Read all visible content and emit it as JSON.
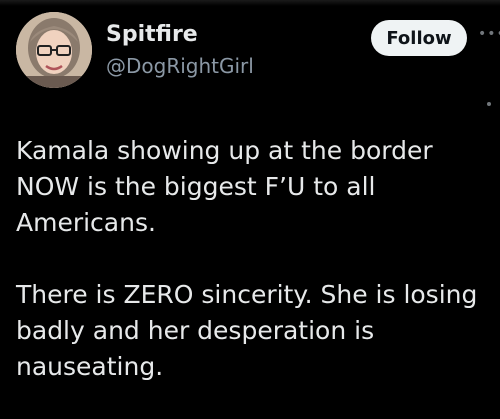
{
  "author": {
    "display_name": "Spitfire",
    "handle": "@DogRightGirl",
    "avatar_icon": "profile-photo"
  },
  "actions": {
    "follow_label": "Follow",
    "more_icon": "more-dots-icon"
  },
  "tweet": {
    "paragraphs": [
      "Kamala showing up at the border NOW is the biggest F’U to all Americans.",
      "There is ZERO sincerity. She is losing badly and her desperation is nauseating."
    ]
  },
  "colors": {
    "background": "#000000",
    "text": "#e7e9ea",
    "secondary_text": "#8b98a5",
    "button_bg": "#eff3f4",
    "button_text": "#0f1419"
  }
}
